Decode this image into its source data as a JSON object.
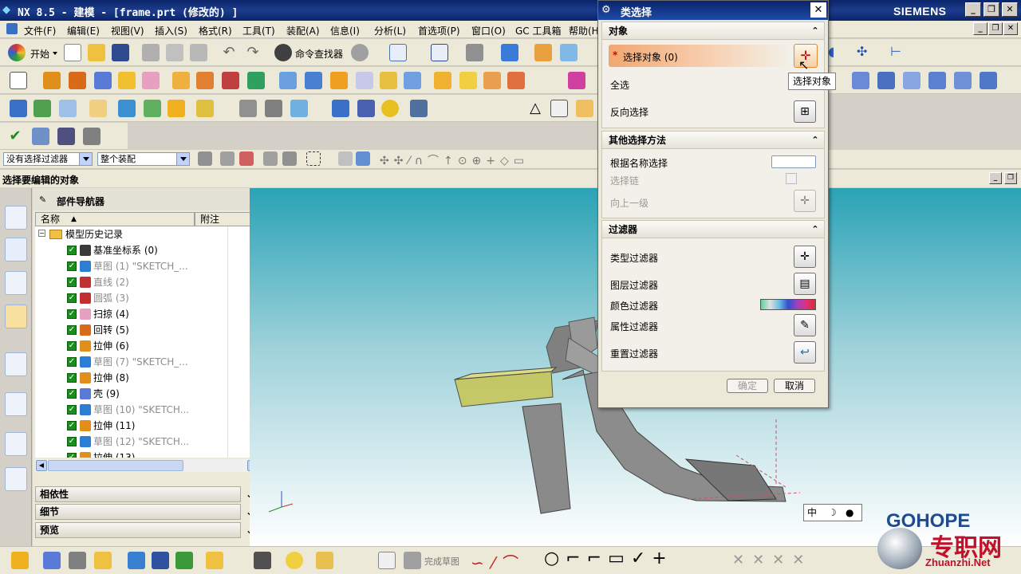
{
  "window": {
    "title": "NX 8.5 - 建模 - [frame.prt (修改的) ]",
    "brand": "SIEMENS"
  },
  "menu": [
    "文件(F)",
    "编辑(E)",
    "视图(V)",
    "插入(S)",
    "格式(R)",
    "工具(T)",
    "装配(A)",
    "信息(I)",
    "分析(L)",
    "首选项(P)",
    "窗口(O)",
    "GC 工具箱",
    "帮助(H)"
  ],
  "toolbar": {
    "start_label": "开始",
    "command_finder": "命令查找器",
    "finish_sketch": "完成草图"
  },
  "selection_bar": {
    "filter_value": "没有选择过滤器",
    "scope_value": "整个装配"
  },
  "cue_line": "选择要编辑的对象",
  "part_navigator": {
    "title": "部件导航器",
    "col_name": "名称",
    "col_notes": "附注",
    "root": "模型历史记录",
    "items": [
      {
        "label": "基准坐标系 (0)",
        "dim": false,
        "color": "#3a3a3a"
      },
      {
        "label": "草图 (1) \"SKETCH_...",
        "dim": true,
        "color": "#2a7fd4"
      },
      {
        "label": "直线 (2)",
        "dim": true,
        "color": "#c03030"
      },
      {
        "label": "圆弧 (3)",
        "dim": true,
        "color": "#c03030"
      },
      {
        "label": "扫掠 (4)",
        "dim": false,
        "color": "#e8a0c0"
      },
      {
        "label": "回转 (5)",
        "dim": false,
        "color": "#d86a1a"
      },
      {
        "label": "拉伸 (6)",
        "dim": false,
        "color": "#e0901a"
      },
      {
        "label": "草图 (7) \"SKETCH_...",
        "dim": true,
        "color": "#2a7fd4"
      },
      {
        "label": "拉伸 (8)",
        "dim": false,
        "color": "#e0901a"
      },
      {
        "label": "壳 (9)",
        "dim": false,
        "color": "#5a7ad8"
      },
      {
        "label": "草图 (10) \"SKETCH...",
        "dim": true,
        "color": "#2a7fd4"
      },
      {
        "label": "拉伸 (11)",
        "dim": false,
        "color": "#e0901a"
      },
      {
        "label": "草图 (12) \"SKETCH...",
        "dim": true,
        "color": "#2a7fd4"
      },
      {
        "label": "拉伸 (13)",
        "dim": false,
        "color": "#e0901a"
      }
    ],
    "panels": [
      "相依性",
      "细节",
      "预览"
    ]
  },
  "dialog": {
    "title": "类选择",
    "section_object": "对象",
    "select_object": "选择对象 (0)",
    "select_all": "全选",
    "invert": "反向选择",
    "section_other": "其他选择方法",
    "by_name": "根据名称选择",
    "select_chain": "选择链",
    "up_one_level": "向上一级",
    "section_filter": "过滤器",
    "type_filter": "类型过滤器",
    "layer_filter": "图层过滤器",
    "color_filter": "颜色过滤器",
    "attribute_filter": "属性过滤器",
    "reset_filter": "重置过滤器",
    "ok": "确定",
    "cancel": "取消",
    "tooltip": "选择对象"
  },
  "ime": "中",
  "watermark": {
    "brand": "GOHOPE",
    "cn": "专职网",
    "url": "Zhuanzhi.Net"
  },
  "colors": {
    "title_blue": "#0a246a",
    "viewport_top": "#2aa3b6",
    "highlight_orange": "#f2a770"
  }
}
